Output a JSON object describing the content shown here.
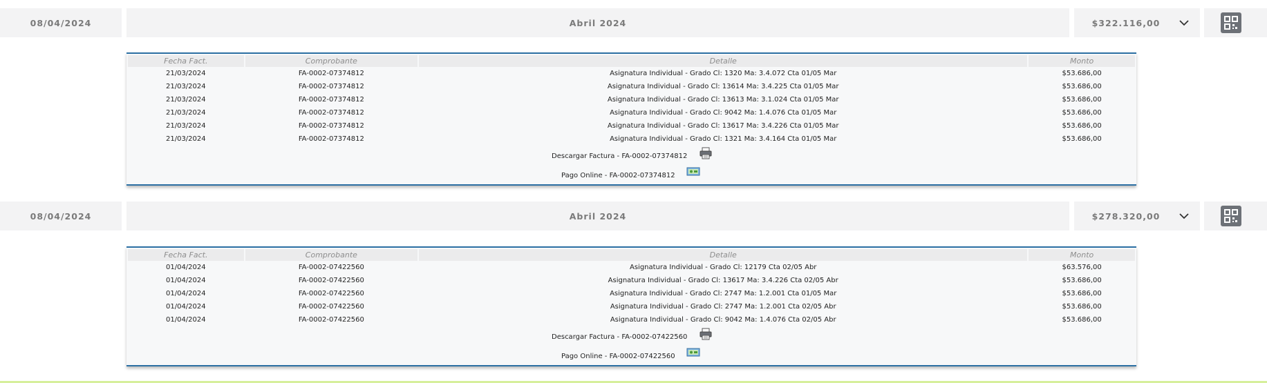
{
  "invoices": [
    {
      "date": "08/04/2024",
      "period": "Abril 2024",
      "amount": "$322.116,00",
      "headers": [
        "Fecha Fact.",
        "Comprobante",
        "Detalle",
        "Monto"
      ],
      "rows": [
        [
          "21/03/2024",
          "FA-0002-07374812",
          "Asignatura Individual - Grado Cl: 1320 Ma: 3.4.072 Cta 01/05 Mar",
          "$53.686,00"
        ],
        [
          "21/03/2024",
          "FA-0002-07374812",
          "Asignatura Individual - Grado Cl: 13614 Ma: 3.4.225 Cta 01/05 Mar",
          "$53.686,00"
        ],
        [
          "21/03/2024",
          "FA-0002-07374812",
          "Asignatura Individual - Grado Cl: 13613 Ma: 3.1.024 Cta 01/05 Mar",
          "$53.686,00"
        ],
        [
          "21/03/2024",
          "FA-0002-07374812",
          "Asignatura Individual - Grado Cl: 9042 Ma: 1.4.076 Cta 01/05 Mar",
          "$53.686,00"
        ],
        [
          "21/03/2024",
          "FA-0002-07374812",
          "Asignatura Individual - Grado Cl: 13617 Ma: 3.4.226 Cta 01/05 Mar",
          "$53.686,00"
        ],
        [
          "21/03/2024",
          "FA-0002-07374812",
          "Asignatura Individual - Grado Cl: 1321 Ma: 3.4.164 Cta 01/05 Mar",
          "$53.686,00"
        ]
      ],
      "download_label": "Descargar Factura - FA-0002-07374812",
      "pay_label": "Pago Online - FA-0002-07374812"
    },
    {
      "date": "08/04/2024",
      "period": "Abril 2024",
      "amount": "$278.320,00",
      "headers": [
        "Fecha Fact.",
        "Comprobante",
        "Detalle",
        "Monto"
      ],
      "rows": [
        [
          "01/04/2024",
          "FA-0002-07422560",
          "Asignatura Individual - Grado Cl: 12179 Cta 02/05 Abr",
          "$63.576,00"
        ],
        [
          "01/04/2024",
          "FA-0002-07422560",
          "Asignatura Individual - Grado Cl: 13617 Ma: 3.4.226 Cta 02/05 Abr",
          "$53.686,00"
        ],
        [
          "01/04/2024",
          "FA-0002-07422560",
          "Asignatura Individual - Grado Cl: 2747 Ma: 1.2.001 Cta 01/05 Mar",
          "$53.686,00"
        ],
        [
          "01/04/2024",
          "FA-0002-07422560",
          "Asignatura Individual - Grado Cl: 2747 Ma: 1.2.001 Cta 02/05 Abr",
          "$53.686,00"
        ],
        [
          "01/04/2024",
          "FA-0002-07422560",
          "Asignatura Individual - Grado Cl: 9042 Ma: 1.4.076 Cta 02/05 Abr",
          "$53.686,00"
        ]
      ],
      "download_label": "Descargar Factura - FA-0002-07422560",
      "pay_label": "Pago Online - FA-0002-07422560"
    }
  ],
  "icons": {
    "expand": "chevron-down-icon",
    "qr": "qr-code-icon",
    "download": "printer-icon",
    "pay": "online-payment-icon"
  },
  "colors": {
    "header_bg": "#f3f3f4",
    "panel_border": "#2b6fa3",
    "qr_button": "#6d7177",
    "bottom_accent": "#d6ef9b"
  }
}
